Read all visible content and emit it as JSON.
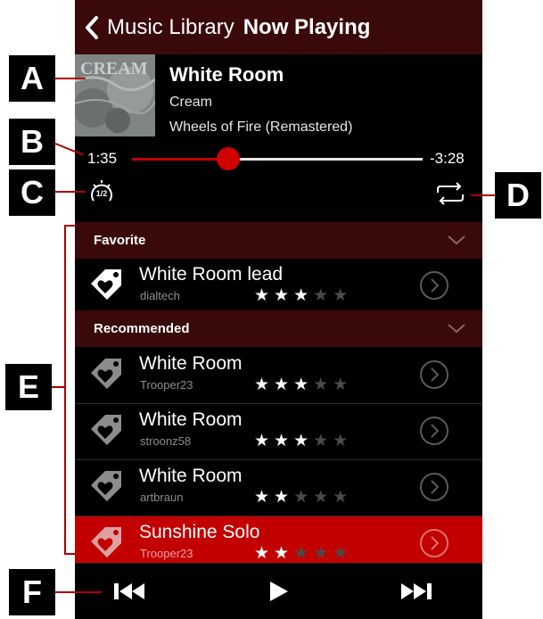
{
  "nav": {
    "back_label": "Music Library",
    "title": "Now Playing"
  },
  "track": {
    "title": "White Room",
    "artist": "Cream",
    "album": "Wheels of Fire (Remastered)",
    "album_art_text": "CREAM"
  },
  "progress": {
    "elapsed": "1:35",
    "remaining": "-3:28",
    "position_fraction": 0.33
  },
  "controls": {
    "speed_icon": "playback-speed-half-icon",
    "speed_label": "1/2",
    "repeat_icon": "repeat-icon"
  },
  "sections": [
    {
      "label": "Favorite",
      "items": [
        {
          "title": "White Room lead",
          "user": "dialtech",
          "rating": 3,
          "selected": false
        }
      ]
    },
    {
      "label": "Recommended",
      "items": [
        {
          "title": "White Room",
          "user": "Trooper23",
          "rating": 3,
          "selected": false
        },
        {
          "title": "White Room",
          "user": "stroonz58",
          "rating": 3,
          "selected": false
        },
        {
          "title": "White Room",
          "user": "artbraun",
          "rating": 2,
          "selected": false
        },
        {
          "title": "Sunshine Solo",
          "user": "Trooper23",
          "rating": 2,
          "selected": true
        }
      ]
    }
  ],
  "player": {
    "prev_icon": "skip-back-icon",
    "play_icon": "play-icon",
    "next_icon": "skip-forward-icon"
  },
  "callouts": {
    "a": "A",
    "b": "B",
    "c": "C",
    "d": "D",
    "e": "E",
    "f": "F"
  },
  "colors": {
    "accent_red": "#c30000",
    "header_maroon": "#3a0a0a",
    "star_on": "#ffffff",
    "star_off": "#4a4a4a"
  }
}
